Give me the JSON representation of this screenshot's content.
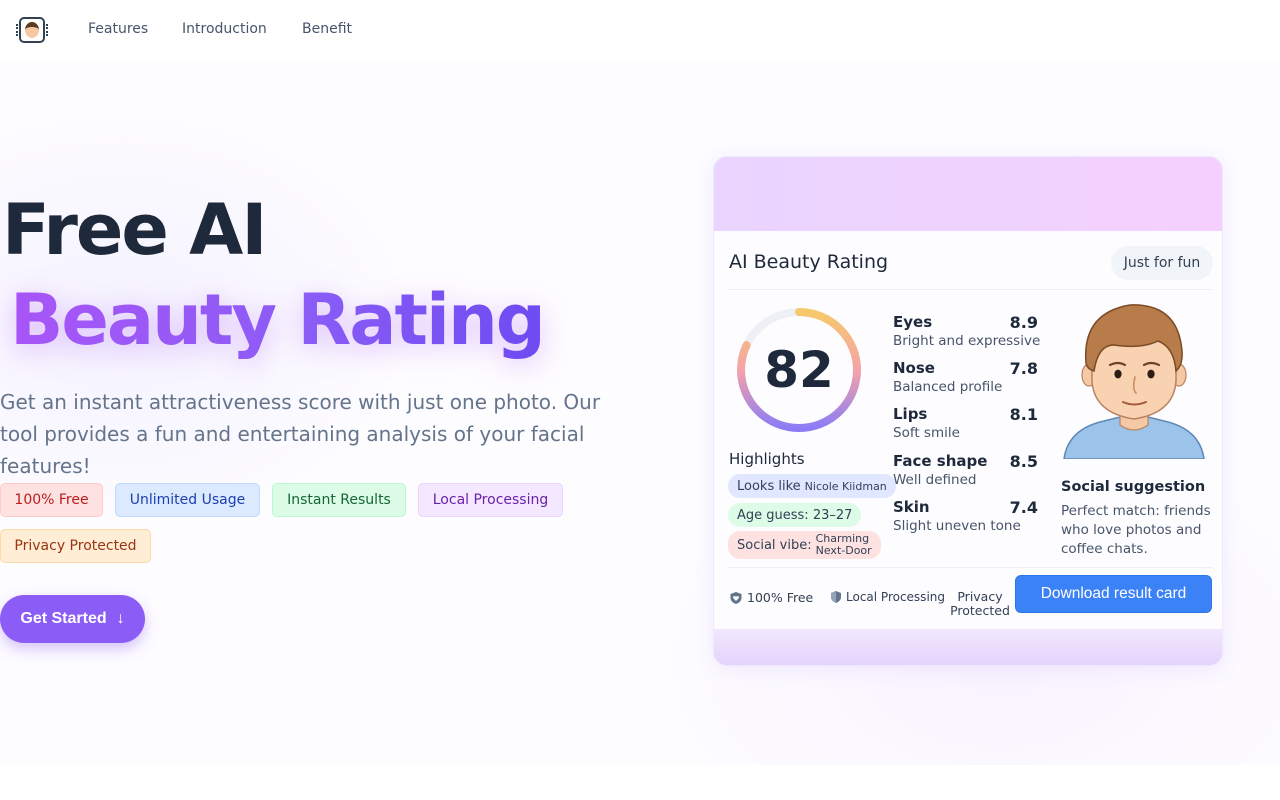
{
  "nav": {
    "logo_icon": "robot-face-chip-icon",
    "links": [
      "Features",
      "Introduction",
      "Benefit"
    ]
  },
  "hero": {
    "title_line1": "Free AI",
    "title_line2": "Beauty Rating",
    "description": "Get an instant attractiveness score with just one photo. Our tool provides a fun and entertaining analysis of your facial features!",
    "badges": [
      "100% Free",
      "Unlimited Usage",
      "Instant Results",
      "Local Processing",
      "Privacy Protected"
    ],
    "cta_label": "Get Started",
    "cta_icon": "arrow-down-icon"
  },
  "card": {
    "title": "AI Beauty Rating",
    "pill": "Just for fun",
    "score": "82",
    "score_fraction": 0.82,
    "highlights_title": "Highlights",
    "highlights": {
      "looks_like_label": "Looks like",
      "looks_like_value": "Nicole Kiidman",
      "age_guess": "Age guess: 23–27",
      "social_vibe_label": "Social vibe:",
      "social_vibe_line1": "Charming",
      "social_vibe_line2": "Next-Door"
    },
    "metrics": [
      {
        "name": "Eyes",
        "value": "8.9",
        "desc": "Bright and expressive"
      },
      {
        "name": "Nose",
        "value": "7.8",
        "desc": "Balanced profile"
      },
      {
        "name": "Lips",
        "value": "8.1",
        "desc": "Soft smile"
      },
      {
        "name": "Face shape",
        "value": "8.5",
        "desc": "Well defined"
      },
      {
        "name": "Skin",
        "value": "7.4",
        "desc": "Slight uneven tone"
      }
    ],
    "suggestion_title": "Social suggestion",
    "suggestion_text": "Perfect match: friends who love photos and coffee chats.",
    "footer": {
      "free_label": "100% Free",
      "free_icon": "heart-shield-icon",
      "local_label": "Local Processing",
      "local_icon": "shield-icon",
      "privacy_label": "Privacy Protected",
      "download_label": "Download result card"
    },
    "colors": {
      "ring_start": "#8b7cf6",
      "ring_mid": "#f5a3a8",
      "ring_end": "#f6c96b",
      "download": "#3b82f6"
    }
  }
}
